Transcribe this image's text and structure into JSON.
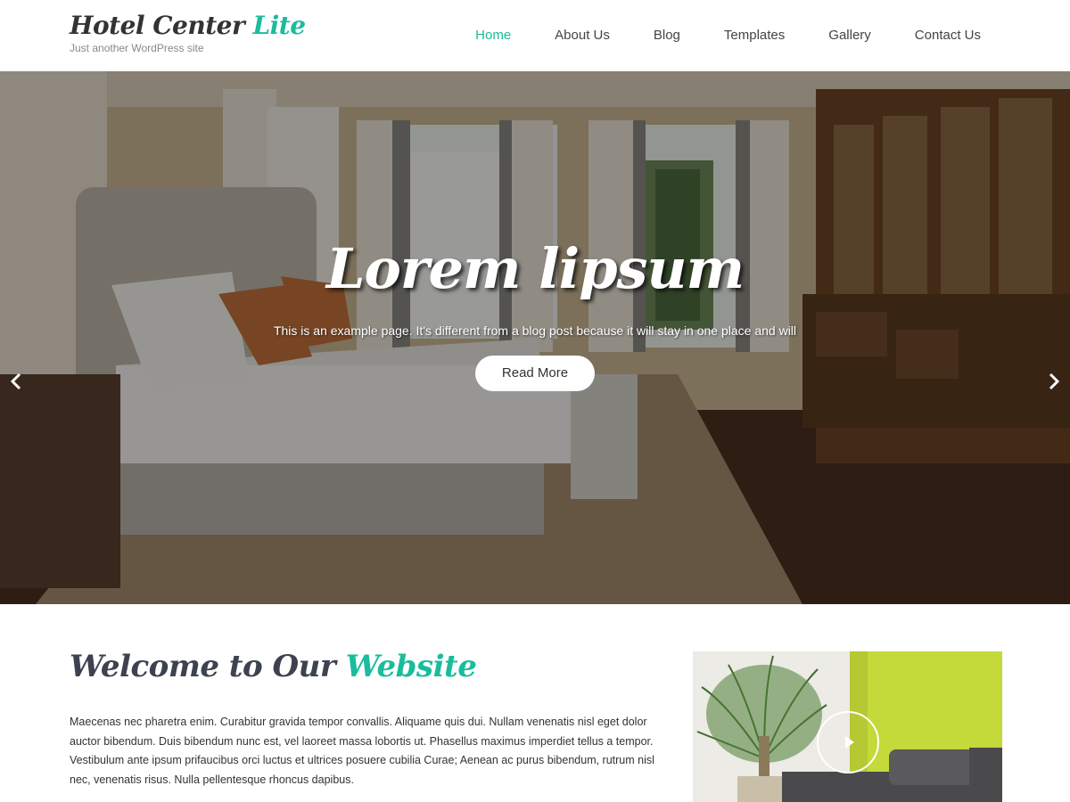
{
  "header": {
    "site_title_main": "Hotel Center",
    "site_title_accent": "Lite",
    "tagline": "Just another WordPress site"
  },
  "nav": {
    "items": [
      {
        "label": "Home",
        "active": true
      },
      {
        "label": "About Us",
        "active": false
      },
      {
        "label": "Blog",
        "active": false
      },
      {
        "label": "Templates",
        "active": false
      },
      {
        "label": "Gallery",
        "active": false
      },
      {
        "label": "Contact Us",
        "active": false
      }
    ]
  },
  "slider": {
    "title": "Lorem lipsum",
    "text": "This is an example page. It's different from a blog post because it will stay in one place and will",
    "button_label": "Read More",
    "prev_icon": "chevron-left-icon",
    "next_icon": "chevron-right-icon"
  },
  "welcome": {
    "title_main": "Welcome to Our",
    "title_accent": "Website",
    "body": "Maecenas nec pharetra enim. Curabitur gravida tempor convallis. Aliquame quis dui. Nullam venenatis nisl eget dolor auctor bibendum. Duis bibendum nunc est, vel laoreet massa lobortis ut. Phasellus maximus imperdiet tellus a tempor. Vestibulum ante ipsum prifaucibus orci luctus et ultrices posuere cubilia Curae; Aenean ac purus bibendum, rutrum nisl nec, venenatis risus. Nulla pellentesque rhoncus dapibus.",
    "play_icon": "play-icon"
  },
  "colors": {
    "accent": "#1abc9c",
    "text_dark": "#333333",
    "heading": "#3d4250"
  }
}
